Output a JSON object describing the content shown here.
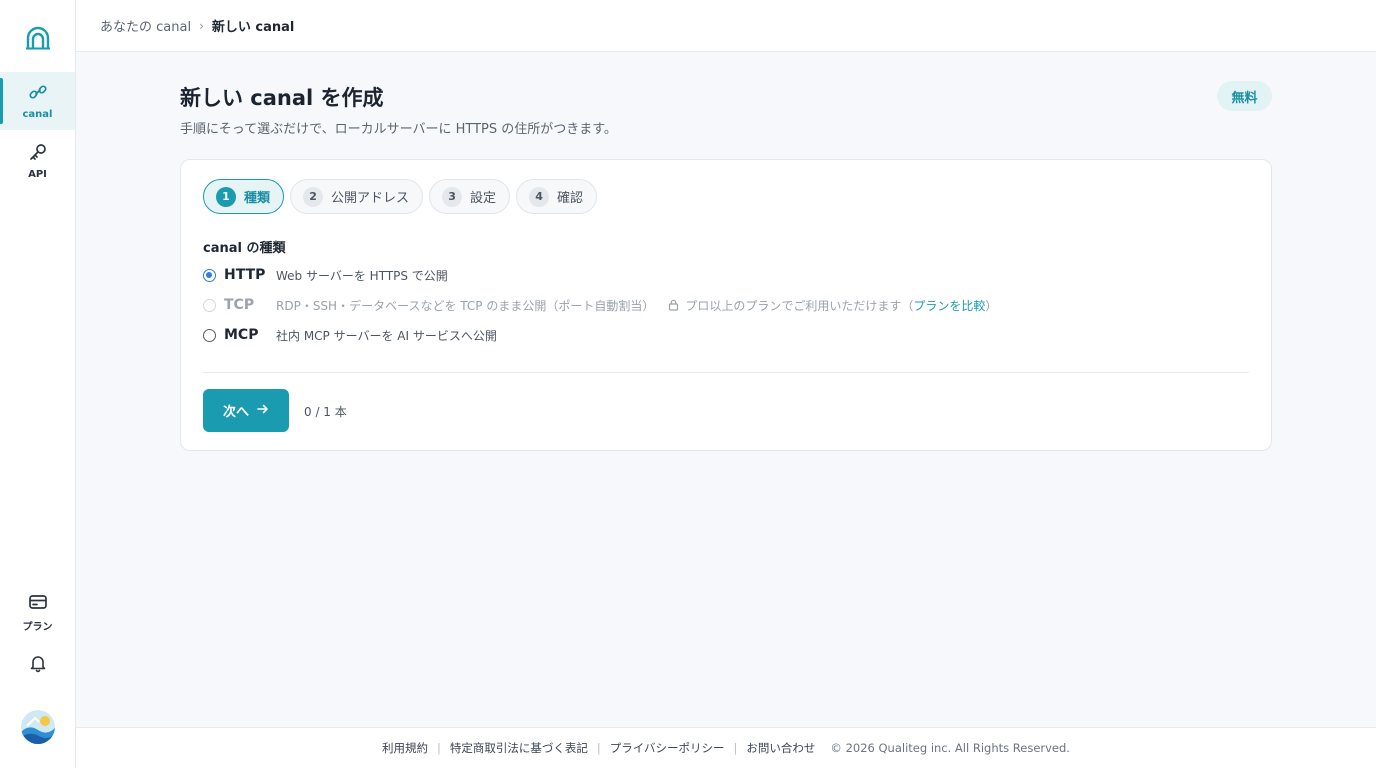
{
  "sidebar": {
    "items": [
      {
        "label": "canal",
        "icon": "link-icon",
        "active": true
      },
      {
        "label": "API",
        "icon": "key-icon",
        "active": false
      },
      {
        "label": "プラン",
        "icon": "card-icon",
        "active": false
      }
    ]
  },
  "breadcrumb": {
    "parent": "あなたの canal",
    "current": "新しい canal"
  },
  "page": {
    "title": "新しい canal を作成",
    "subtitle": "手順にそって選ぶだけで、ローカルサーバーに HTTPS の住所がつきます。",
    "badge": "無料"
  },
  "steps": [
    {
      "num": "1",
      "label": "種類",
      "active": true
    },
    {
      "num": "2",
      "label": "公開アドレス",
      "active": false
    },
    {
      "num": "3",
      "label": "設定",
      "active": false
    },
    {
      "num": "4",
      "label": "確認",
      "active": false
    }
  ],
  "form": {
    "section_label": "canal の種類",
    "options": [
      {
        "name": "HTTP",
        "desc": "Web サーバーを HTTPS で公開",
        "checked": true,
        "disabled": false
      },
      {
        "name": "TCP",
        "desc": "RDP・SSH・データベースなどを TCP のまま公開（ポート自動割当）",
        "note": "プロ以上のプランでご利用いただけます（",
        "link": "プランを比較",
        "note_end": "）",
        "checked": false,
        "disabled": true
      },
      {
        "name": "MCP",
        "desc": "社内 MCP サーバーを AI サービスへ公開",
        "checked": false,
        "disabled": false
      }
    ],
    "next_label": "次へ",
    "count": "0 / 1 本"
  },
  "footer": {
    "links": [
      "利用規約",
      "特定商取引法に基づく表記",
      "プライバシーポリシー",
      "お問い合わせ"
    ],
    "copyright": "© 2026 Qualiteg inc. All Rights Reserved."
  },
  "colors": {
    "accent": "#1a9bb0",
    "radio": "#2f7de1"
  }
}
